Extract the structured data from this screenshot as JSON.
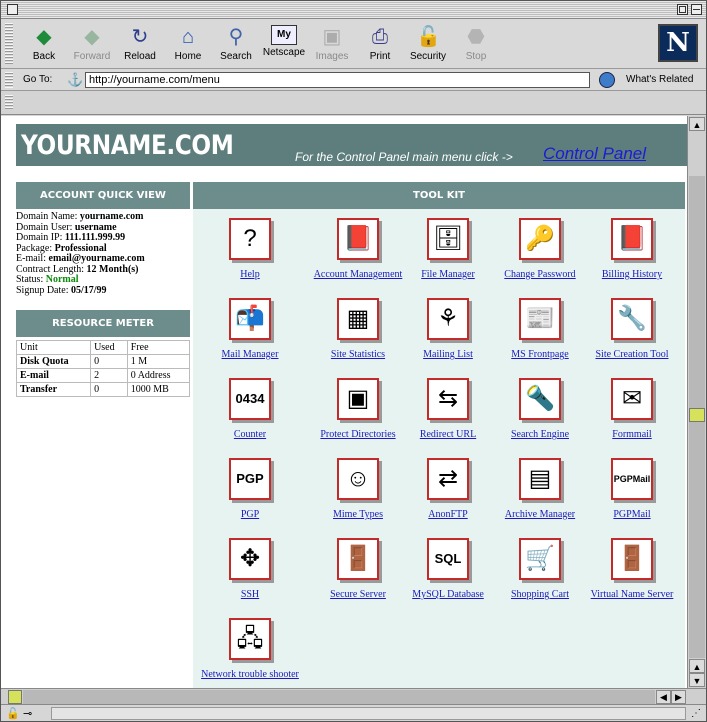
{
  "window": {
    "title": ""
  },
  "toolbar": {
    "buttons": [
      {
        "label": "Back",
        "icon": "back-arrow-icon",
        "enabled": true
      },
      {
        "label": "Forward",
        "icon": "forward-arrow-icon",
        "enabled": false
      },
      {
        "label": "Reload",
        "icon": "reload-icon",
        "enabled": true
      },
      {
        "label": "Home",
        "icon": "home-icon",
        "enabled": true
      },
      {
        "label": "Search",
        "icon": "search-icon",
        "enabled": true
      },
      {
        "label": "Netscape",
        "icon": "netscape-icon",
        "enabled": true
      },
      {
        "label": "Images",
        "icon": "images-icon",
        "enabled": false
      },
      {
        "label": "Print",
        "icon": "print-icon",
        "enabled": true
      },
      {
        "label": "Security",
        "icon": "security-lock-icon",
        "enabled": true
      },
      {
        "label": "Stop",
        "icon": "stop-icon",
        "enabled": false
      }
    ],
    "logo_letter": "N"
  },
  "location": {
    "label": "Go To:",
    "url": "http://yourname.com/menu",
    "whats_related": "What's Related"
  },
  "banner": {
    "logo": "YOURNAME.COM",
    "cp_text": "For the Control Panel main menu click ->",
    "cp_link": "Control Panel"
  },
  "account": {
    "heading": "ACCOUNT QUICK VIEW",
    "domain_name_label": "Domain Name:",
    "domain_name": "yourname.com",
    "domain_user_label": "Domain User:",
    "domain_user": "username",
    "domain_ip_label": "Domain IP:",
    "domain_ip": "111.111.999.99",
    "package_label": "Package:",
    "package": "Professional",
    "email_label": "E-mail:",
    "email": "email@yourname.com",
    "contract_label": "Contract Length:",
    "contract": "12 Month(s)",
    "status_label": "Status:",
    "status": "Normal",
    "signup_label": "Signup Date:",
    "signup": "05/17/99"
  },
  "resource": {
    "heading": "RESOURCE METER",
    "columns": [
      "Unit",
      "Used",
      "Free"
    ],
    "rows": [
      [
        "Disk Quota",
        "0",
        "1 M"
      ],
      [
        "E-mail",
        "2",
        "0 Address"
      ],
      [
        "Transfer",
        "0",
        "1000 MB"
      ]
    ]
  },
  "toolkit": {
    "heading": "TOOL KIT",
    "tools": [
      {
        "label": "Help",
        "icon": "help-sign-icon",
        "glyph": "?"
      },
      {
        "label": "Account Management",
        "icon": "account-book-icon",
        "glyph": "📕"
      },
      {
        "label": "File Manager",
        "icon": "file-cabinet-icon",
        "glyph": "🗄"
      },
      {
        "label": "Change Password",
        "icon": "key-icon",
        "glyph": "🔑"
      },
      {
        "label": "Billing History",
        "icon": "billing-book-icon",
        "glyph": "📕"
      },
      {
        "label": "Mail Manager",
        "icon": "mailbox-icon",
        "glyph": "📬"
      },
      {
        "label": "Site Statistics",
        "icon": "statistics-cube-icon",
        "glyph": "▦"
      },
      {
        "label": "Mailing List",
        "icon": "mailing-list-icon",
        "glyph": "⚘"
      },
      {
        "label": "MS Frontpage",
        "icon": "newspaper-icon",
        "glyph": "📰"
      },
      {
        "label": "Site Creation Tool",
        "icon": "wrench-icon",
        "glyph": "🔧"
      },
      {
        "label": "Counter",
        "icon": "counter-icon",
        "glyph": "0434"
      },
      {
        "label": "Protect Directories",
        "icon": "safe-icon",
        "glyph": "▣"
      },
      {
        "label": "Redirect URL",
        "icon": "redirect-arrows-icon",
        "glyph": "⇆"
      },
      {
        "label": "Search Engine",
        "icon": "flashlight-icon",
        "glyph": "🔦"
      },
      {
        "label": "Formmail",
        "icon": "formmail-icon",
        "glyph": "✉"
      },
      {
        "label": "PGP",
        "icon": "pgp-icon",
        "glyph": "PGP"
      },
      {
        "label": "Mime Types",
        "icon": "mime-character-icon",
        "glyph": "☺"
      },
      {
        "label": "AnonFTP",
        "icon": "ftp-server-icon",
        "glyph": "⇄"
      },
      {
        "label": "Archive Manager",
        "icon": "archive-vise-icon",
        "glyph": "▤"
      },
      {
        "label": "PGPMail",
        "icon": "pgpmail-icon",
        "glyph": "PGPMail"
      },
      {
        "label": "SSH",
        "icon": "ssh-arrows-icon",
        "glyph": "✥"
      },
      {
        "label": "Secure Server",
        "icon": "secure-door-icon",
        "glyph": "🚪"
      },
      {
        "label": "MySQL Database",
        "icon": "mysql-icon",
        "glyph": "SQL"
      },
      {
        "label": "Shopping Cart",
        "icon": "shopping-cart-icon",
        "glyph": "🛒"
      },
      {
        "label": "Virtual Name Server",
        "icon": "name-server-door-icon",
        "glyph": "🚪"
      },
      {
        "label": "Network trouble shooter",
        "icon": "network-computers-icon",
        "glyph": "🖧"
      }
    ]
  },
  "colors": {
    "header_teal": "#6d8c8c",
    "banner_teal": "#5e7d7d",
    "toolkit_bg": "#e6f3f0",
    "link_blue": "#1b1bbd",
    "icon_border": "#c32a2a",
    "status_green": "#0d8a0d"
  }
}
